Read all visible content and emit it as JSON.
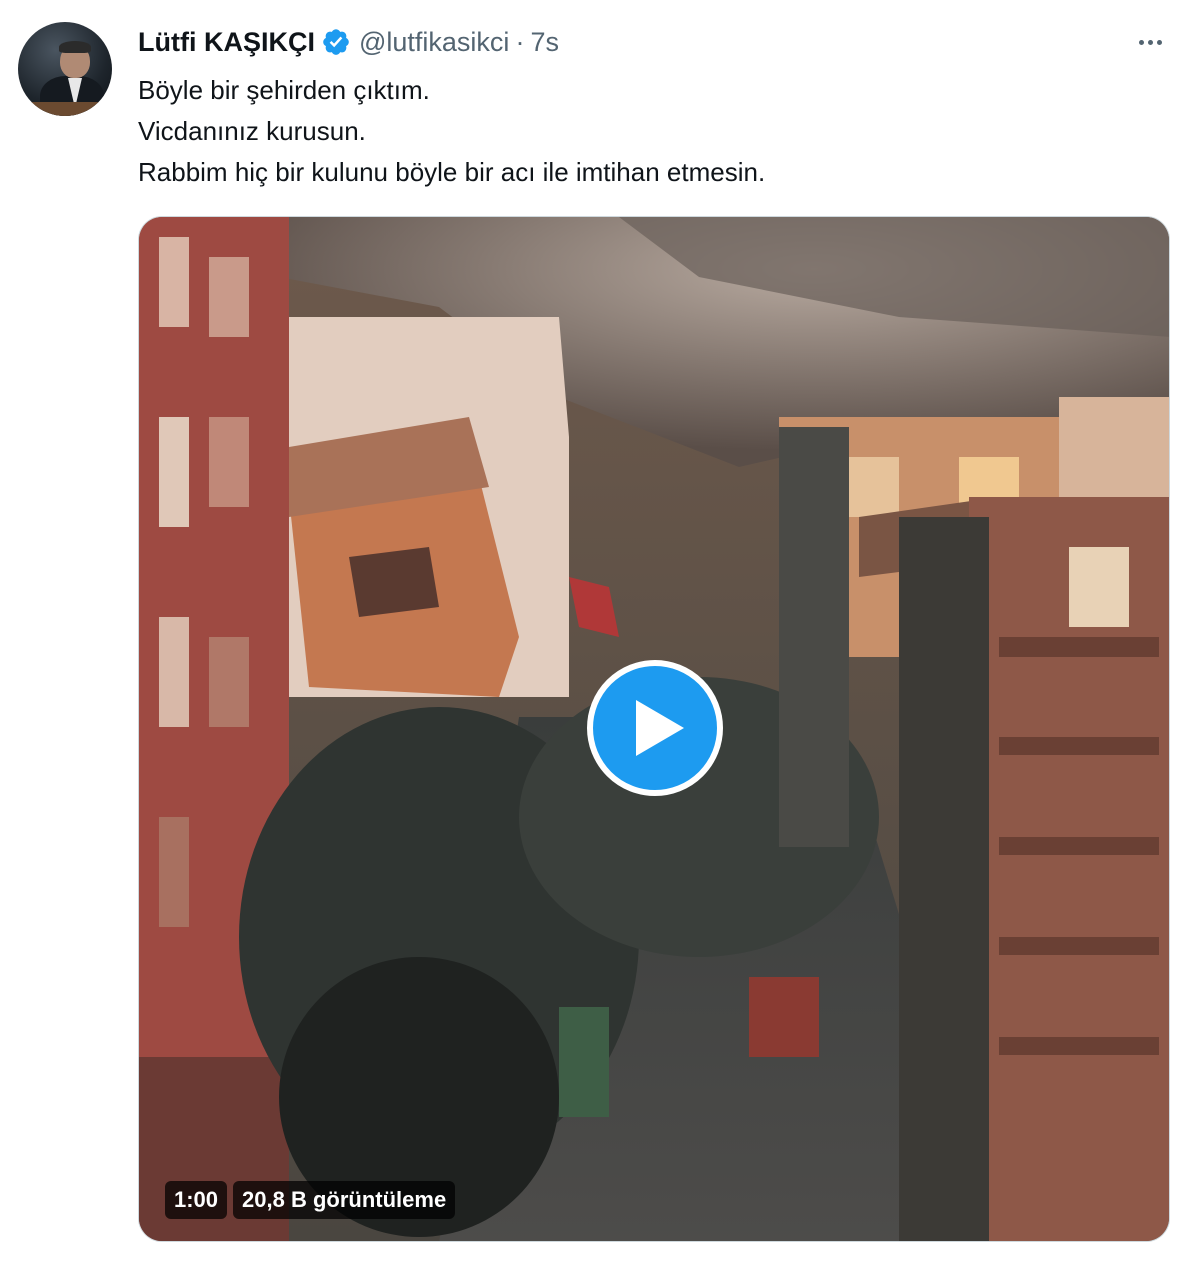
{
  "author": {
    "name": "Lütfi KAŞIKÇI",
    "handle": "@lutfikasikci",
    "separator": "·",
    "time": "7s"
  },
  "tweet": {
    "lines": [
      "Böyle bir şehirden çıktım.",
      "Vicdanınız kurusun.",
      "Rabbim hiç bir kulunu böyle bir acı ile imtihan etmesin."
    ]
  },
  "video": {
    "duration": "1:00",
    "views": "20,8 B görüntüleme"
  },
  "icons": {
    "verified": "verified-badge-icon",
    "more": "more-options-icon",
    "play": "play-icon"
  },
  "colors": {
    "accent": "#1d9bf0",
    "text": "#0f1419",
    "secondary": "#536471"
  }
}
